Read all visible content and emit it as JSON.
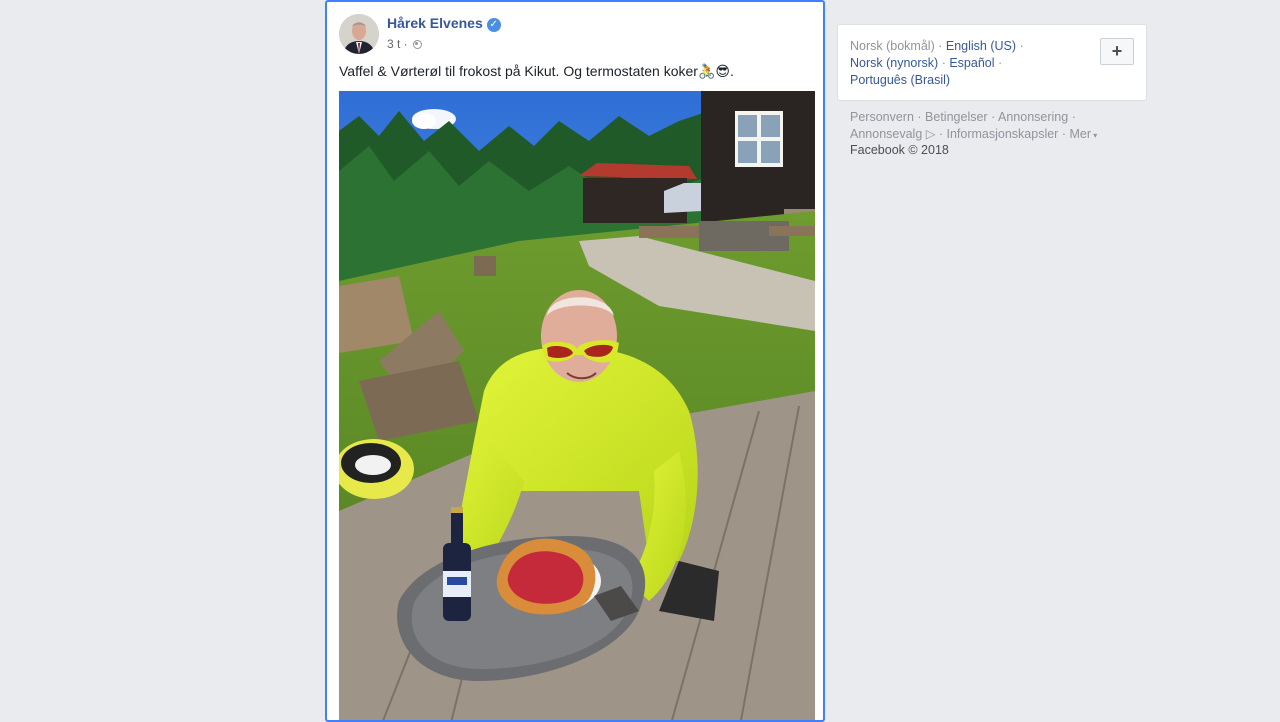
{
  "post": {
    "author": "Hårek Elvenes",
    "verified_icon": "verified-badge-icon",
    "time": "3 t",
    "separator": " · ",
    "privacy_icon": "public-globe-icon",
    "text": "Vaffel & Vørterøl til frokost på Kikut. Og termostaten koker",
    "emoji_bike": "🚴",
    "emoji_sunglasses": "😎",
    "text_end": "."
  },
  "languages": {
    "current": "Norsk (bokmål)",
    "links": [
      "English (US)",
      "Norsk (nynorsk)",
      "Español",
      "Português (Brasil)"
    ],
    "add_button": "+"
  },
  "footer": {
    "links": [
      "Personvern",
      "Betingelser",
      "Annonsering",
      "Annonsevalg",
      "Informasjonskapsler",
      "Mer"
    ],
    "copyright": "Facebook © 2018"
  },
  "colors": {
    "background": "#e9ebee",
    "link": "#365899",
    "selected_border": "#4080ff"
  }
}
